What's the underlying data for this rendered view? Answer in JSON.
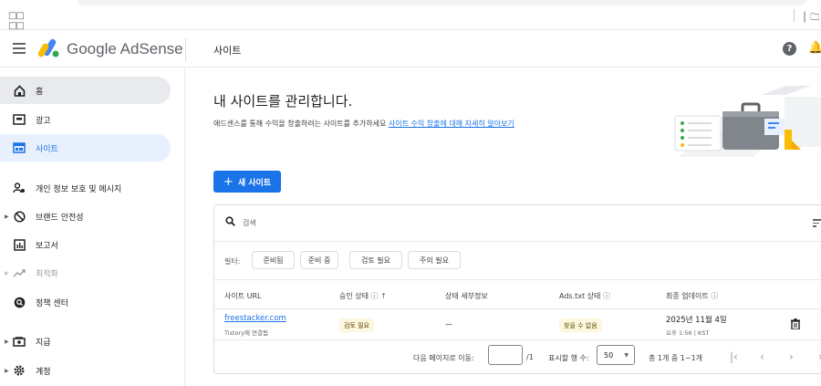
{
  "browser": {
    "apps_icon": "apps-grid-icon",
    "folder_label": "│ 🗀 모"
  },
  "header": {
    "brand": "Google AdSense",
    "page_title": "사이트"
  },
  "sidebar": {
    "items": [
      {
        "label": "홈",
        "icon": "home-icon"
      },
      {
        "label": "광고",
        "icon": "ads-icon"
      },
      {
        "label": "사이트",
        "icon": "sites-icon"
      },
      {
        "label": "개인 정보 보호 및 메시지",
        "icon": "privacy-icon"
      },
      {
        "label": "브랜드 안전성",
        "icon": "block-icon"
      },
      {
        "label": "보고서",
        "icon": "report-icon"
      },
      {
        "label": "최적화",
        "icon": "trend-icon"
      },
      {
        "label": "정책 센터",
        "icon": "policy-icon"
      },
      {
        "label": "지급",
        "icon": "payments-icon"
      },
      {
        "label": "계정",
        "icon": "settings-icon"
      }
    ]
  },
  "main": {
    "heading": "내 사이트를 관리합니다.",
    "subtitle": "애드센스를 통해 수익을 창출하려는 사이트를 추가하세요",
    "subtitle_link": "사이트 수익 창출에 대해 자세히 알아보기",
    "new_site_button": "새 사이트"
  },
  "table": {
    "search_placeholder": "검색",
    "filter_label": "필터:",
    "filters": [
      "준비됨",
      "준비 중",
      "검토 필요",
      "주의 필요"
    ],
    "columns": [
      "사이트 URL",
      "승인 상태",
      "상태 세부정보",
      "Ads.txt 상태",
      "최종 업데이트"
    ],
    "rows": [
      {
        "url": "freestacker.com",
        "connection": "Tistory에 연결됨",
        "approval": "검토 필요",
        "detail": "—",
        "adstxt": "찾을 수 없음",
        "updated_date": "2025년 11월 4일",
        "updated_time": "오후 1:56 | KST"
      }
    ],
    "pager": {
      "goto_label": "다음 페이지로 이동:",
      "page_total": "/1",
      "rows_label": "표시할 행 수:",
      "rows_value": "50",
      "range": "총 1개 중 1~1개"
    }
  }
}
